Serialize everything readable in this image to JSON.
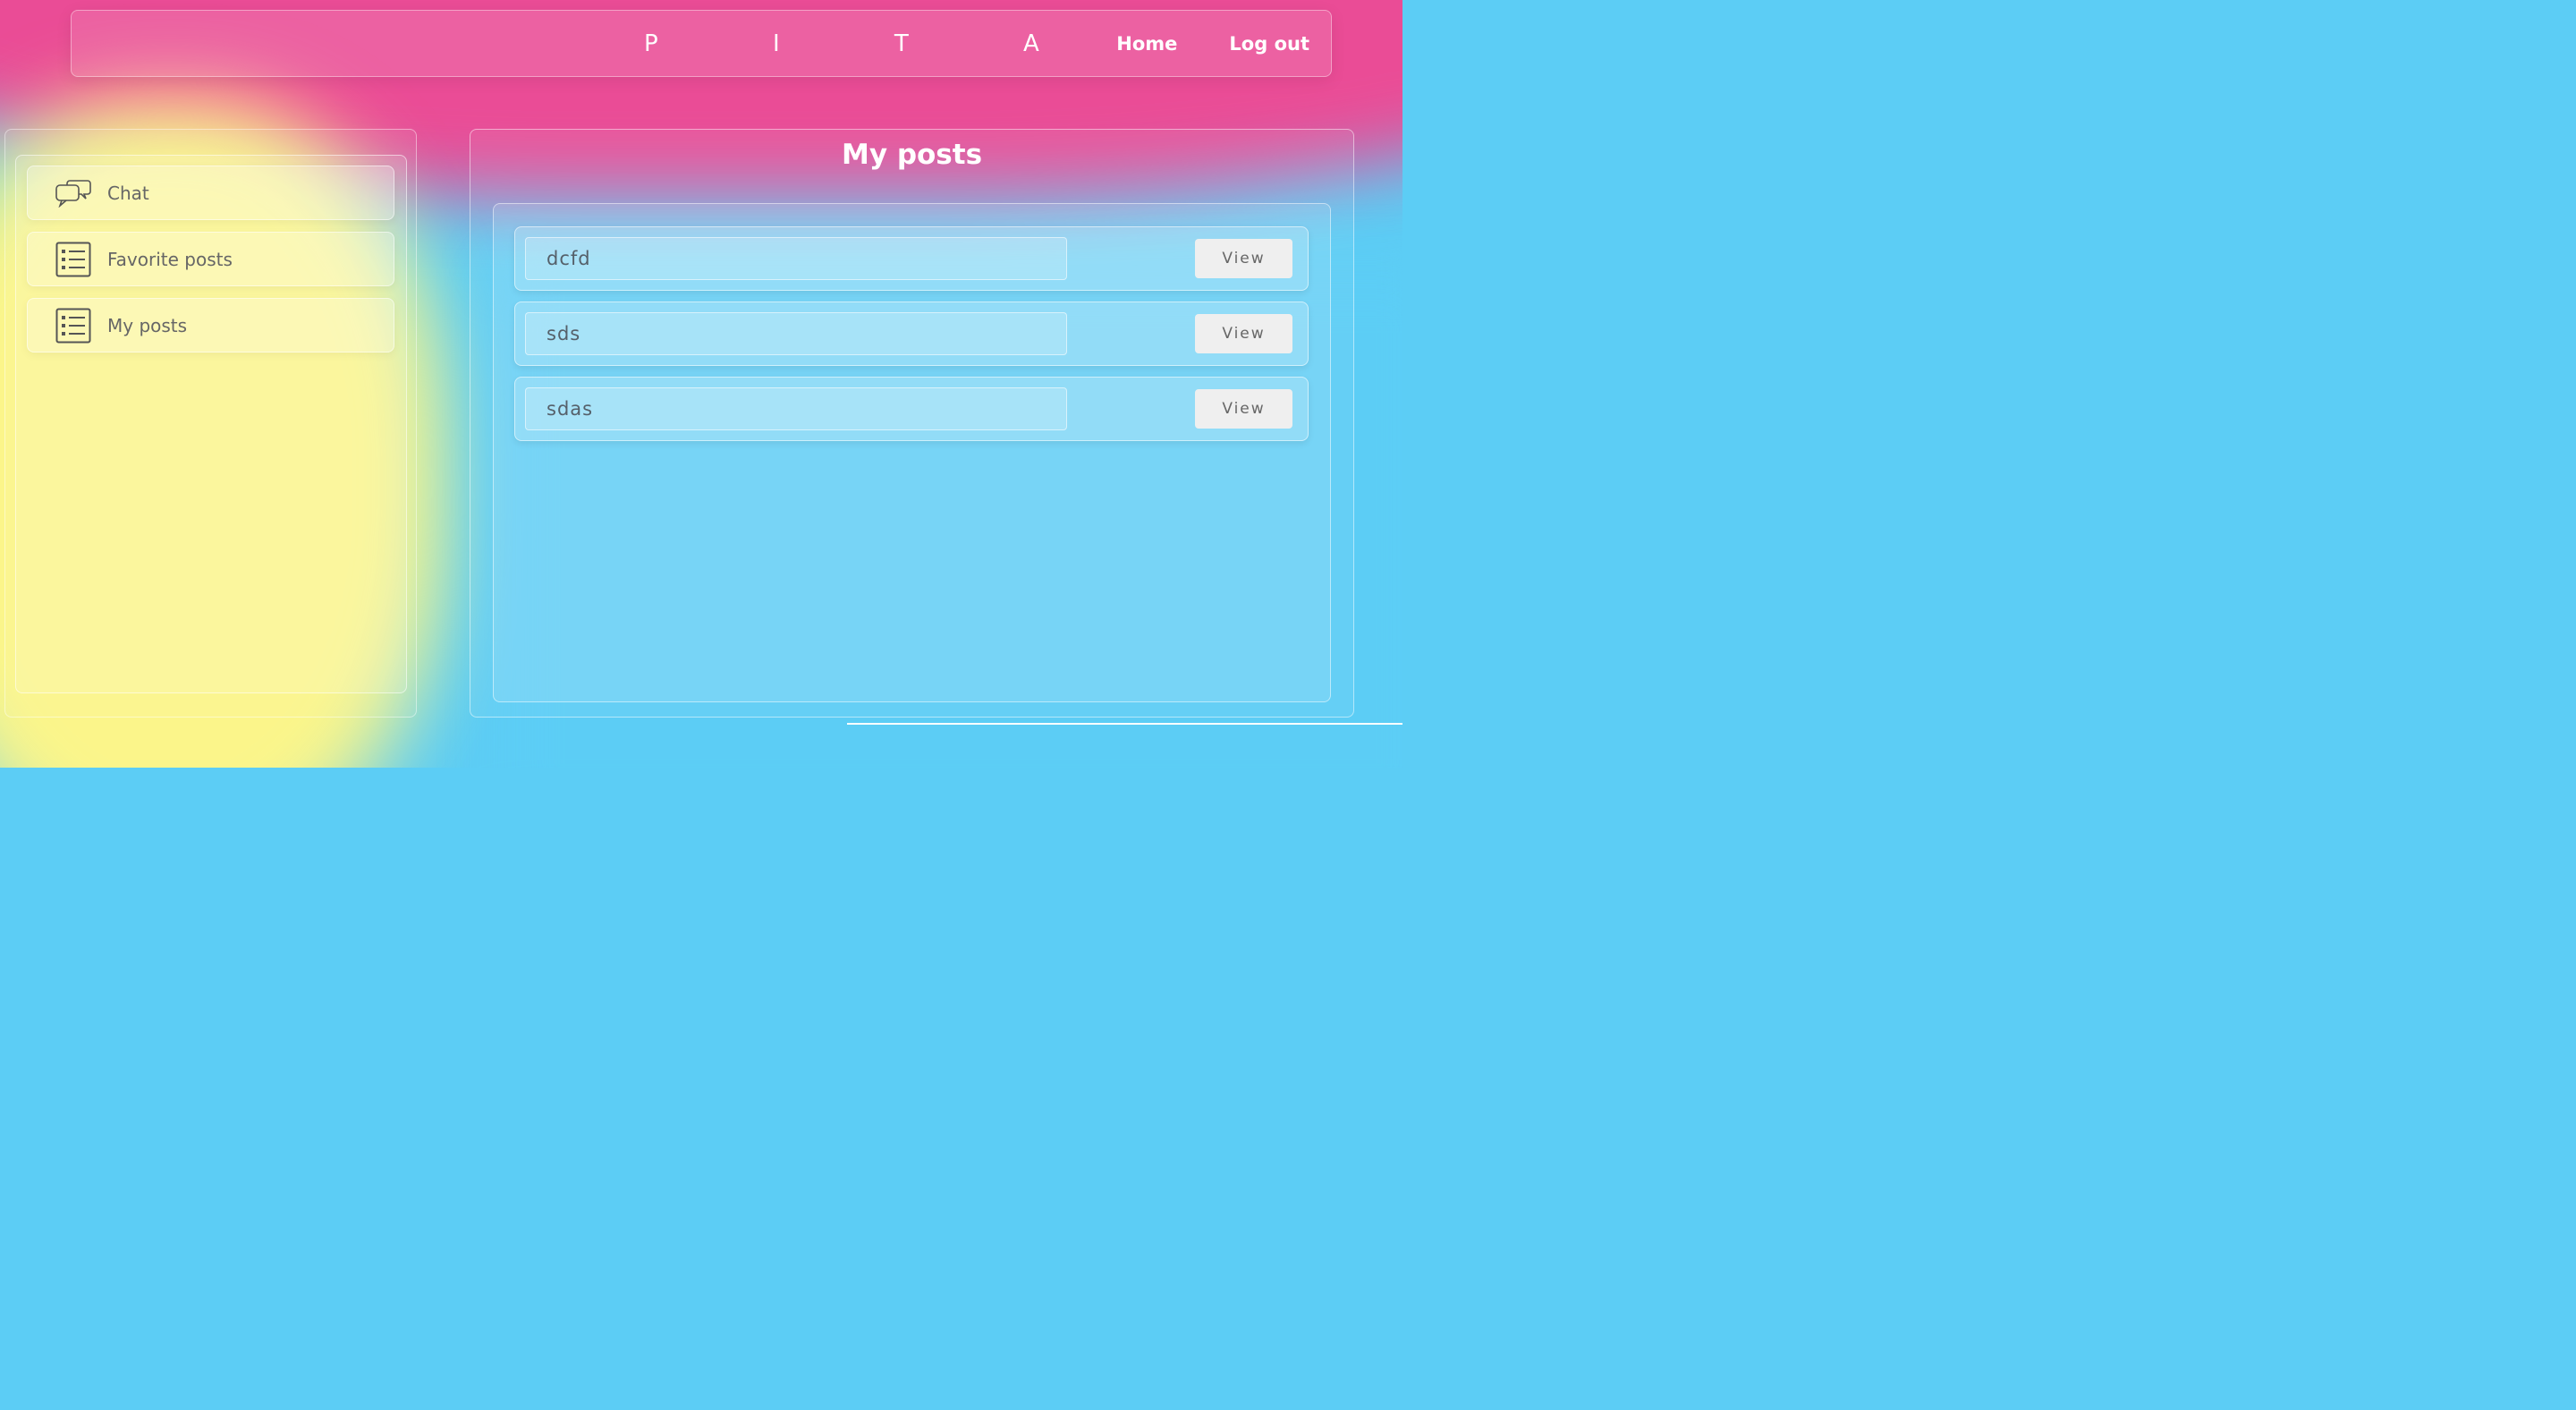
{
  "header": {
    "brand": "P I T A",
    "nav": [
      {
        "label": "Home"
      },
      {
        "label": "Log out"
      }
    ]
  },
  "sidebar": {
    "items": [
      {
        "label": "Chat",
        "icon": "chat-bubbles-icon"
      },
      {
        "label": "Favorite posts",
        "icon": "list-icon"
      },
      {
        "label": "My posts",
        "icon": "list-icon"
      }
    ]
  },
  "main": {
    "title": "My posts",
    "posts": [
      {
        "name": "dcfd",
        "action": "View"
      },
      {
        "name": "sds",
        "action": "View"
      },
      {
        "name": "sdas",
        "action": "View"
      }
    ]
  },
  "colors": {
    "pink": "#ea4c96",
    "yellow": "#fbf58a",
    "blue": "#5ccdf5"
  }
}
